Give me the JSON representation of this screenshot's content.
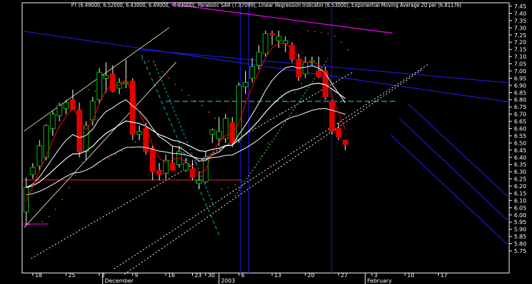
{
  "chart_data": {
    "type": "candlestick",
    "title": "PT (6.49000, 6.52000, 6.43000, 6.49000, -0.03000), Parabolic SAR (7.07099), Linear Regression Indicator (6.53000), Exponential Moving Average 20 per (6.81176)",
    "ylim": [
      5.7,
      7.5
    ],
    "y_ticks": [
      "7.45",
      "7.40",
      "7.35",
      "7.30",
      "7.25",
      "7.20",
      "7.15",
      "7.10",
      "7.05",
      "7.00",
      "6.95",
      "6.90",
      "6.85",
      "6.80",
      "6.75",
      "6.70",
      "6.65",
      "6.60",
      "6.55",
      "6.50",
      "6.45",
      "6.40",
      "6.35",
      "6.30",
      "6.25",
      "6.20",
      "6.15",
      "6.10",
      "6.05",
      "6.00",
      "5.95",
      "5.90",
      "5.85",
      "5.80",
      "5.75"
    ],
    "x_ticks": [
      {
        "label": "18",
        "i": 1.5
      },
      {
        "label": "25",
        "i": 6.5
      },
      {
        "label": "2",
        "i": 11.5
      },
      {
        "label": "9",
        "i": 16.5
      },
      {
        "label": "16",
        "i": 21.5
      },
      {
        "label": "23",
        "i": 25.5
      },
      {
        "label": "30",
        "i": 27.5
      },
      {
        "label": "6",
        "i": 32.5
      },
      {
        "label": "13",
        "i": 37.5
      },
      {
        "label": "20",
        "i": 42.5
      },
      {
        "label": "27",
        "i": 47.5
      },
      {
        "label": "3",
        "i": 52.5
      },
      {
        "label": "10",
        "i": 57.5
      },
      {
        "label": "17",
        "i": 62.5
      }
    ],
    "month_labels": [
      {
        "label": "December",
        "i": 12.0
      },
      {
        "label": "2003",
        "i": 29.5
      },
      {
        "label": "February",
        "i": 51.5
      }
    ],
    "candles": [
      {
        "o": 6.02,
        "h": 6.26,
        "l": 5.93,
        "c": 6.19,
        "col": "green"
      },
      {
        "o": 6.28,
        "h": 6.36,
        "l": 6.25,
        "c": 6.33,
        "col": "green"
      },
      {
        "o": 6.34,
        "h": 6.52,
        "l": 6.31,
        "c": 6.48,
        "col": "green"
      },
      {
        "o": 6.4,
        "h": 6.63,
        "l": 6.38,
        "c": 6.62,
        "col": "green"
      },
      {
        "o": 6.6,
        "h": 6.72,
        "l": 6.55,
        "c": 6.7,
        "col": "green"
      },
      {
        "o": 6.69,
        "h": 6.78,
        "l": 6.65,
        "c": 6.76,
        "col": "green"
      },
      {
        "o": 6.74,
        "h": 6.8,
        "l": 6.7,
        "c": 6.78,
        "col": "green"
      },
      {
        "o": 6.8,
        "h": 6.87,
        "l": 6.75,
        "c": 6.73,
        "col": "red"
      },
      {
        "o": 6.73,
        "h": 6.78,
        "l": 6.4,
        "c": 6.44,
        "col": "red"
      },
      {
        "o": 6.44,
        "h": 6.65,
        "l": 6.38,
        "c": 6.62,
        "col": "green"
      },
      {
        "o": 6.66,
        "h": 6.82,
        "l": 6.62,
        "c": 6.79,
        "col": "green"
      },
      {
        "o": 6.8,
        "h": 7.02,
        "l": 6.77,
        "c": 6.99,
        "col": "green"
      },
      {
        "o": 6.97,
        "h": 7.06,
        "l": 6.85,
        "c": 6.95,
        "col": "green"
      },
      {
        "o": 6.98,
        "h": 7.04,
        "l": 6.85,
        "c": 6.86,
        "col": "red"
      },
      {
        "o": 6.88,
        "h": 6.95,
        "l": 6.84,
        "c": 6.92,
        "col": "green"
      },
      {
        "o": 6.92,
        "h": 7.08,
        "l": 6.88,
        "c": 6.91,
        "col": "green"
      },
      {
        "o": 6.93,
        "h": 6.95,
        "l": 6.52,
        "c": 6.56,
        "col": "red"
      },
      {
        "o": 6.58,
        "h": 6.62,
        "l": 6.52,
        "c": 6.56,
        "col": "green"
      },
      {
        "o": 6.6,
        "h": 6.64,
        "l": 6.42,
        "c": 6.44,
        "col": "red"
      },
      {
        "o": 6.46,
        "h": 6.48,
        "l": 6.24,
        "c": 6.3,
        "col": "red"
      },
      {
        "o": 6.31,
        "h": 6.36,
        "l": 6.24,
        "c": 6.28,
        "col": "red"
      },
      {
        "o": 6.29,
        "h": 6.42,
        "l": 6.25,
        "c": 6.38,
        "col": "green"
      },
      {
        "o": 6.36,
        "h": 6.48,
        "l": 6.33,
        "c": 6.31,
        "col": "red"
      },
      {
        "o": 6.35,
        "h": 6.48,
        "l": 6.33,
        "c": 6.44,
        "col": "green"
      },
      {
        "o": 6.36,
        "h": 6.39,
        "l": 6.3,
        "c": 6.31,
        "col": "green"
      },
      {
        "o": 6.32,
        "h": 6.38,
        "l": 6.24,
        "c": 6.26,
        "col": "red"
      },
      {
        "o": 6.24,
        "h": 6.3,
        "l": 6.18,
        "c": 6.22,
        "col": "green"
      },
      {
        "o": 6.23,
        "h": 6.44,
        "l": 6.22,
        "c": 6.4,
        "col": "green"
      },
      {
        "o": 6.56,
        "h": 6.6,
        "l": 6.5,
        "c": 6.59,
        "col": "green"
      },
      {
        "o": 6.58,
        "h": 6.68,
        "l": 6.48,
        "c": 6.53,
        "col": "green"
      },
      {
        "o": 6.53,
        "h": 6.7,
        "l": 6.5,
        "c": 6.67,
        "col": "green"
      },
      {
        "o": 6.64,
        "h": 6.68,
        "l": 6.47,
        "c": 6.5,
        "col": "red"
      },
      {
        "o": 6.52,
        "h": 6.92,
        "l": 6.5,
        "c": 6.9,
        "col": "green"
      },
      {
        "o": 6.89,
        "h": 7.0,
        "l": 6.84,
        "c": 6.92,
        "col": "green"
      },
      {
        "o": 6.95,
        "h": 7.09,
        "l": 6.92,
        "c": 7.03,
        "col": "green"
      },
      {
        "o": 7.04,
        "h": 7.18,
        "l": 7.01,
        "c": 7.13,
        "col": "green"
      },
      {
        "o": 7.12,
        "h": 7.28,
        "l": 7.1,
        "c": 7.26,
        "col": "green"
      },
      {
        "o": 7.26,
        "h": 7.28,
        "l": 7.18,
        "c": 7.25,
        "col": "red"
      },
      {
        "o": 7.24,
        "h": 7.28,
        "l": 7.16,
        "c": 7.21,
        "col": "green"
      },
      {
        "o": 7.21,
        "h": 7.24,
        "l": 7.13,
        "c": 7.19,
        "col": "green"
      },
      {
        "o": 7.18,
        "h": 7.2,
        "l": 7.06,
        "c": 7.08,
        "col": "red"
      },
      {
        "o": 7.08,
        "h": 7.12,
        "l": 6.93,
        "c": 6.96,
        "col": "red"
      },
      {
        "o": 6.98,
        "h": 7.1,
        "l": 6.95,
        "c": 7.06,
        "col": "green"
      },
      {
        "o": 7.06,
        "h": 7.1,
        "l": 7.04,
        "c": 7.07,
        "col": "green"
      },
      {
        "o": 7.0,
        "h": 7.1,
        "l": 6.95,
        "c": 6.96,
        "col": "red"
      },
      {
        "o": 7.0,
        "h": 7.03,
        "l": 6.8,
        "c": 6.82,
        "col": "red"
      },
      {
        "o": 6.79,
        "h": 6.8,
        "l": 6.56,
        "c": 6.58,
        "col": "red"
      },
      {
        "o": 6.6,
        "h": 6.64,
        "l": 6.52,
        "c": 6.54,
        "col": "red"
      },
      {
        "o": 6.52,
        "h": 6.52,
        "l": 6.45,
        "c": 6.49,
        "col": "red"
      }
    ],
    "colors": {
      "background": "#000000",
      "up": "#00c000",
      "down": "#e00000",
      "flat": "#ffffff",
      "channel": "#2020ff",
      "regression": "#ff0000",
      "ema": "#ffffff",
      "magenta_trend": "#ff00ff",
      "cyan_line": "#00c0c0",
      "vertical_marker": "#1818d0",
      "fan_lines": "#d0d0a0"
    }
  }
}
